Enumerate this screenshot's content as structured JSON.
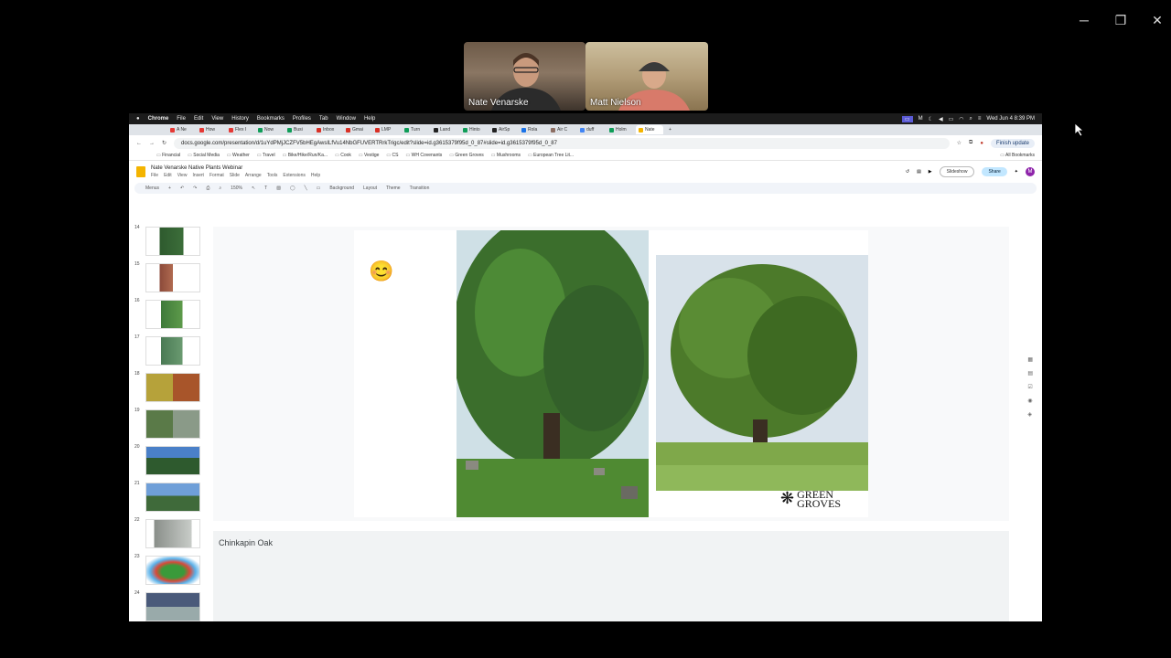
{
  "participants": [
    {
      "name": "Nate Venarske"
    },
    {
      "name": "Matt Nielson"
    }
  ],
  "window_controls": {
    "minimize": "─",
    "restore": "❐",
    "close": "✕"
  },
  "macbar": {
    "app": "Chrome",
    "menus": [
      "File",
      "Edit",
      "View",
      "History",
      "Bookmarks",
      "Profiles",
      "Tab",
      "Window",
      "Help"
    ],
    "clock": "Wed Jun 4  8:39 PM"
  },
  "tabs": [
    {
      "label": "A Ne",
      "color": "#e53935"
    },
    {
      "label": "How",
      "color": "#e53935"
    },
    {
      "label": "Flex I",
      "color": "#e53935"
    },
    {
      "label": "Now",
      "color": "#0f9d58"
    },
    {
      "label": "Busi",
      "color": "#0f9d58"
    },
    {
      "label": "Inbox",
      "color": "#d93025"
    },
    {
      "label": "Gmai",
      "color": "#d93025"
    },
    {
      "label": "LMP",
      "color": "#d93025"
    },
    {
      "label": "Turn",
      "color": "#0f9d58"
    },
    {
      "label": "Land",
      "color": "#222222"
    },
    {
      "label": "Hinto",
      "color": "#0f9d58"
    },
    {
      "label": "AirSp",
      "color": "#222222"
    },
    {
      "label": "Rola",
      "color": "#1a73e8"
    },
    {
      "label": "Air C",
      "color": "#8d6e63"
    },
    {
      "label": "duff",
      "color": "#4285f4"
    },
    {
      "label": "Holm",
      "color": "#0f9d58"
    },
    {
      "label": "Nate",
      "color": "#f4b400"
    }
  ],
  "url": "docs.google.com/presentation/d/1uYdPMjJCZFV5bHEgAwsILfVu14NbGFUVERTRrkTrigc/edit?slide=id.g3615379f95d_0_87#slide=id.g3615379f95d_0_87",
  "finish_update": "Finish update",
  "bookmarks": [
    "Financial",
    "Social Media",
    "Weather",
    "Travel",
    "Bike/Hike/Run/Ka...",
    "Cook",
    "Vestige",
    "CS",
    "WH Covenants",
    "Green Groves",
    "Mushrooms",
    "European Tree Lit..."
  ],
  "all_bookmarks": "All Bookmarks",
  "doc": {
    "title": "Nate Venarske Native Plants Webinar",
    "menus": [
      "File",
      "Edit",
      "View",
      "Insert",
      "Format",
      "Slide",
      "Arrange",
      "Tools",
      "Extensions",
      "Help"
    ],
    "slideshow": "Slideshow",
    "share": "Share",
    "avatar": "M"
  },
  "toolbar": {
    "menus_label": "Menus",
    "zoom": "150%",
    "background": "Background",
    "layout": "Layout",
    "theme": "Theme",
    "transition": "Transition"
  },
  "slides": [
    {
      "num": "14"
    },
    {
      "num": "15"
    },
    {
      "num": "16"
    },
    {
      "num": "17"
    },
    {
      "num": "18"
    },
    {
      "num": "19"
    },
    {
      "num": "20"
    },
    {
      "num": "21"
    },
    {
      "num": "22"
    },
    {
      "num": "23"
    },
    {
      "num": "24"
    }
  ],
  "slide": {
    "emoji": "😊",
    "logo_line1": "GREEN",
    "logo_line2": "GROVES"
  },
  "speaker_notes": "Chinkapin Oak"
}
